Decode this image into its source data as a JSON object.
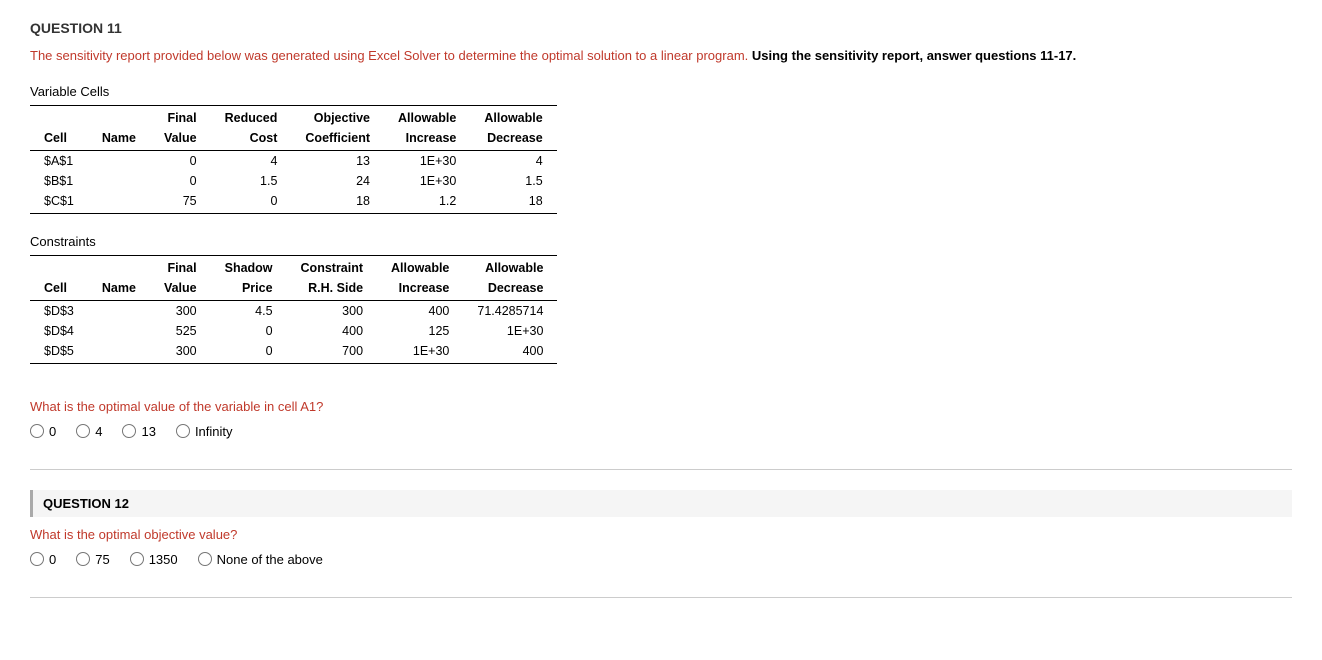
{
  "page": {
    "question11_header": "QUESTION 11",
    "intro_text_plain": "The sensitivity report provided below was generated using Excel Solver to determine the optimal solution to a linear program.",
    "intro_text_bold": "Using the sensitivity report, answer questions 11-17.",
    "variable_cells_title": "Variable Cells",
    "variable_cells_headers_row1": [
      "",
      "",
      "Final",
      "Reduced",
      "Objective",
      "Allowable",
      "Allowable"
    ],
    "variable_cells_headers_row2": [
      "Cell",
      "Name",
      "Value",
      "Cost",
      "Coefficient",
      "Increase",
      "Decrease"
    ],
    "variable_cells_rows": [
      [
        "$A$1",
        "",
        "0",
        "4",
        "13",
        "1E+30",
        "4"
      ],
      [
        "$B$1",
        "",
        "0",
        "1.5",
        "24",
        "1E+30",
        "1.5"
      ],
      [
        "$C$1",
        "",
        "75",
        "0",
        "18",
        "1.2",
        "18"
      ]
    ],
    "constraints_title": "Constraints",
    "constraints_headers_row1": [
      "",
      "",
      "Final",
      "Shadow",
      "Constraint",
      "Allowable",
      "Allowable"
    ],
    "constraints_headers_row2": [
      "Cell",
      "Name",
      "Value",
      "Price",
      "R.H. Side",
      "Increase",
      "Decrease"
    ],
    "constraints_rows": [
      [
        "$D$3",
        "",
        "300",
        "4.5",
        "300",
        "400",
        "71.4285714"
      ],
      [
        "$D$4",
        "",
        "525",
        "0",
        "400",
        "125",
        "1E+30"
      ],
      [
        "$D$5",
        "",
        "300",
        "0",
        "700",
        "1E+30",
        "400"
      ]
    ],
    "q11_text": "What is the optimal value of the variable in cell A1?",
    "q11_options": [
      "0",
      "4",
      "13",
      "Infinity"
    ],
    "question12_header": "QUESTION 12",
    "q12_text": "What is the optimal objective value?",
    "q12_options": [
      "0",
      "75",
      "1350",
      "None of the above"
    ]
  }
}
